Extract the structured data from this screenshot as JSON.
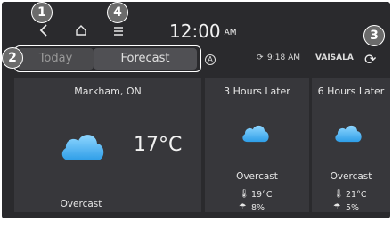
{
  "nav": {
    "back_icon": "chevron-left-icon",
    "home_icon": "home-icon",
    "menu_icon": "menu-icon"
  },
  "clock": {
    "time": "12:00",
    "ampm": "AM"
  },
  "callouts": [
    "1",
    "2",
    "3",
    "4"
  ],
  "tabs": {
    "today": "Today",
    "forecast": "Forecast"
  },
  "status": {
    "time": "9:18 AM",
    "provider": "VAISALA"
  },
  "current": {
    "location": "Markham, ON",
    "temperature": "17°C",
    "condition": "Overcast"
  },
  "forecast": [
    {
      "label": "3 Hours Later",
      "condition": "Overcast",
      "temp": "19°C",
      "precip": "8%"
    },
    {
      "label": "6 Hours Later",
      "condition": "Overcast",
      "temp": "21°C",
      "precip": "5%"
    }
  ],
  "colors": {
    "panel": "#2a2a2d",
    "card": "#37373b",
    "cloud": "#5ec1ff"
  }
}
